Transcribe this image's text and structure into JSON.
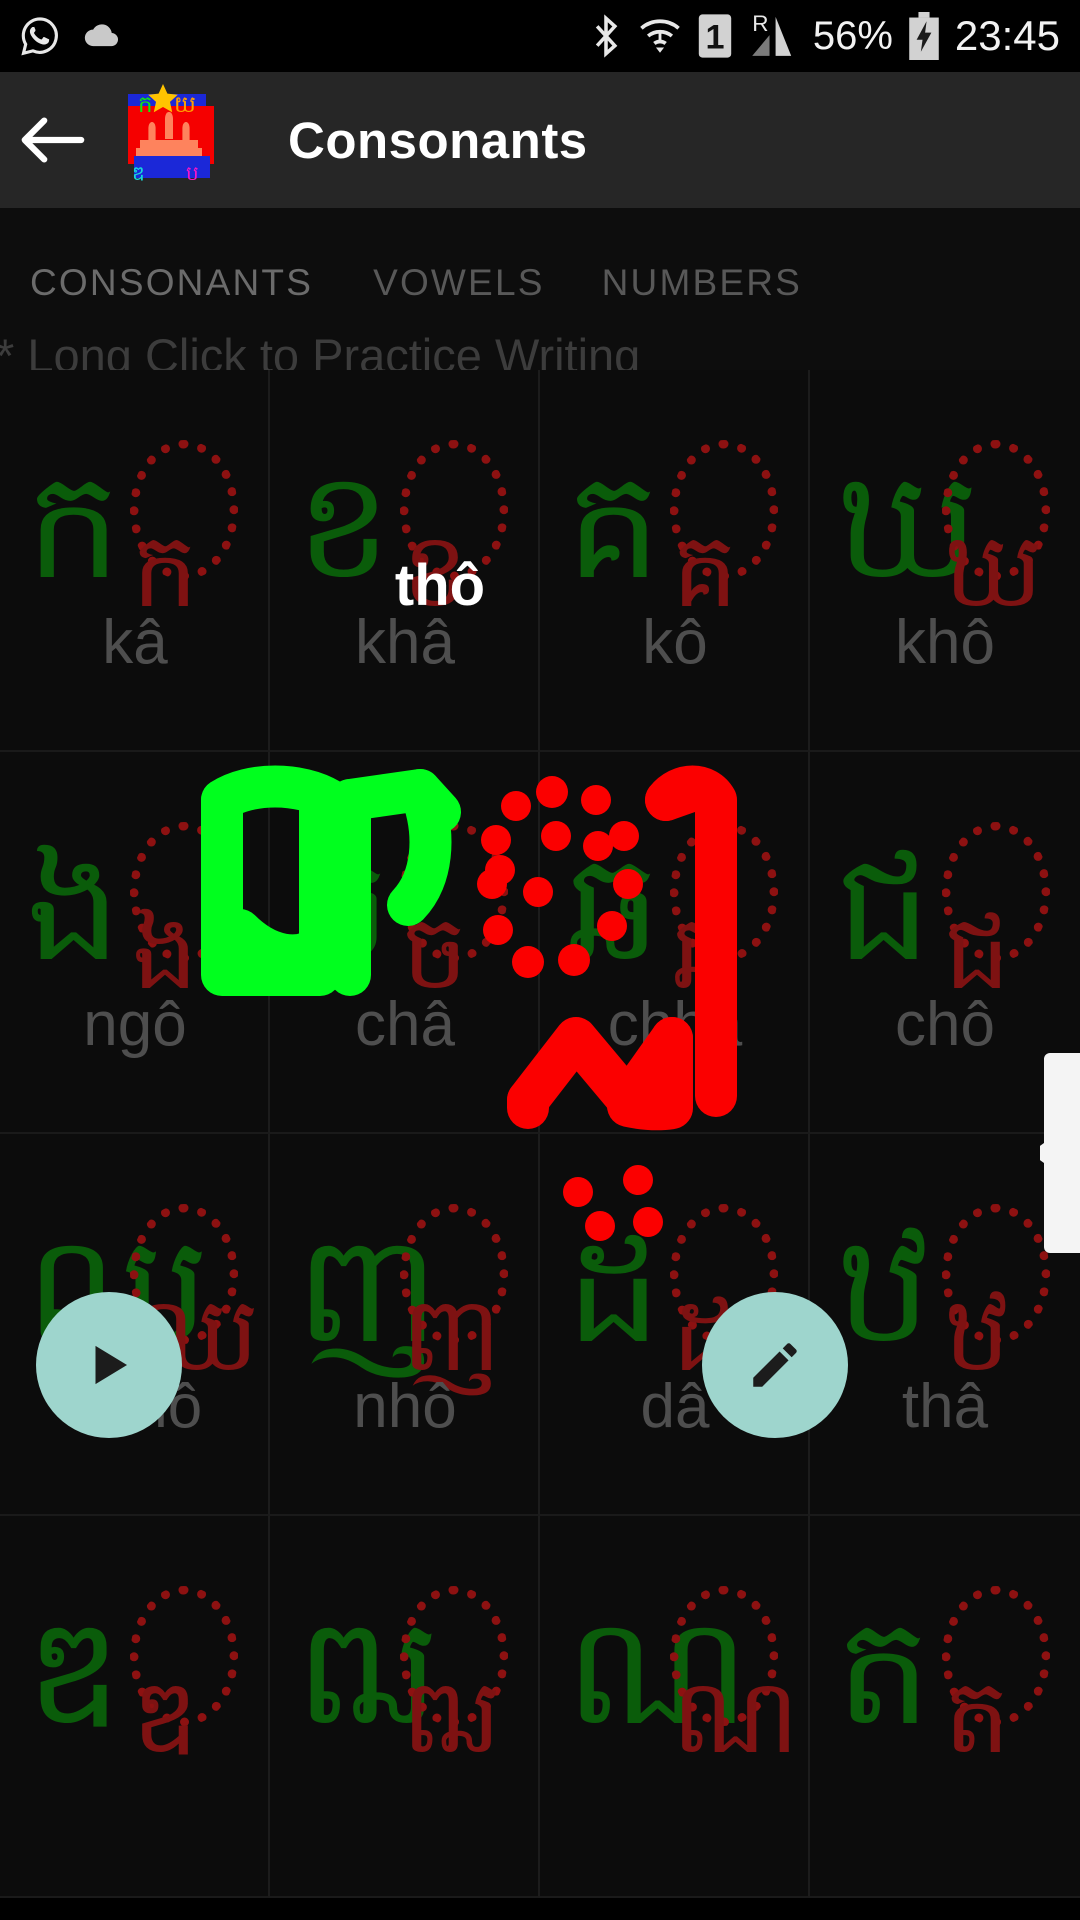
{
  "status_bar": {
    "time": "23:45",
    "battery_pct": "56%",
    "sim_label": "1",
    "roaming_label": "R",
    "icons": [
      "whatsapp-icon",
      "cloud-icon",
      "bluetooth-icon",
      "wifi-icon",
      "sim-icon",
      "roaming-icon",
      "signal-icon",
      "battery-icon"
    ]
  },
  "app_bar": {
    "back_icon": "back-arrow-icon",
    "logo_icon": "cambodia-flag-logo",
    "title": "Consonants"
  },
  "tabs": {
    "items": [
      {
        "label": "CONSONANTS",
        "active": true
      },
      {
        "label": "VOWELS",
        "active": false
      },
      {
        "label": "NUMBERS",
        "active": false
      }
    ],
    "indicator_color": "#2e4a46"
  },
  "hint": "* Long Click to Practice Writing",
  "toast": {
    "text": "thô"
  },
  "grid": {
    "rows": [
      [
        {
          "char": "ក",
          "label": "kâ"
        },
        {
          "char": "ខ",
          "label": "khâ"
        },
        {
          "char": "គ",
          "label": "kô"
        },
        {
          "char": "ឃ",
          "label": "khô"
        }
      ],
      [
        {
          "char": "ង",
          "label": "ngô"
        },
        {
          "char": "ច",
          "label": "châ"
        },
        {
          "char": "ឆ",
          "label": "chhâ"
        },
        {
          "char": "ជ",
          "label": "chô"
        }
      ],
      [
        {
          "char": "ឈ",
          "label": "chhô"
        },
        {
          "char": "ញ",
          "label": "nhô"
        },
        {
          "char": "ដ",
          "label": "dâ"
        },
        {
          "char": "ឋ",
          "label": "thâ"
        }
      ],
      [
        {
          "char": "ឌ",
          "label": ""
        },
        {
          "char": "ឍ",
          "label": ""
        },
        {
          "char": "ណ",
          "label": ""
        },
        {
          "char": "ត",
          "label": ""
        }
      ]
    ],
    "glyph_color": "#0a5c0a",
    "trace_color": "#8d1111",
    "label_color": "#4e4e4e"
  },
  "ink": {
    "stroke_green": "#00ff1e",
    "stroke_red": "#fb0000"
  },
  "fabs": [
    {
      "name": "play",
      "icon": "play-icon",
      "color": "#9ed5cd"
    },
    {
      "name": "edit",
      "icon": "pencil-icon",
      "color": "#9ed5cd"
    }
  ],
  "fast_scroll": {
    "color": "#f4f4f4",
    "icon": "scroll-thumb-arrow-icon"
  }
}
